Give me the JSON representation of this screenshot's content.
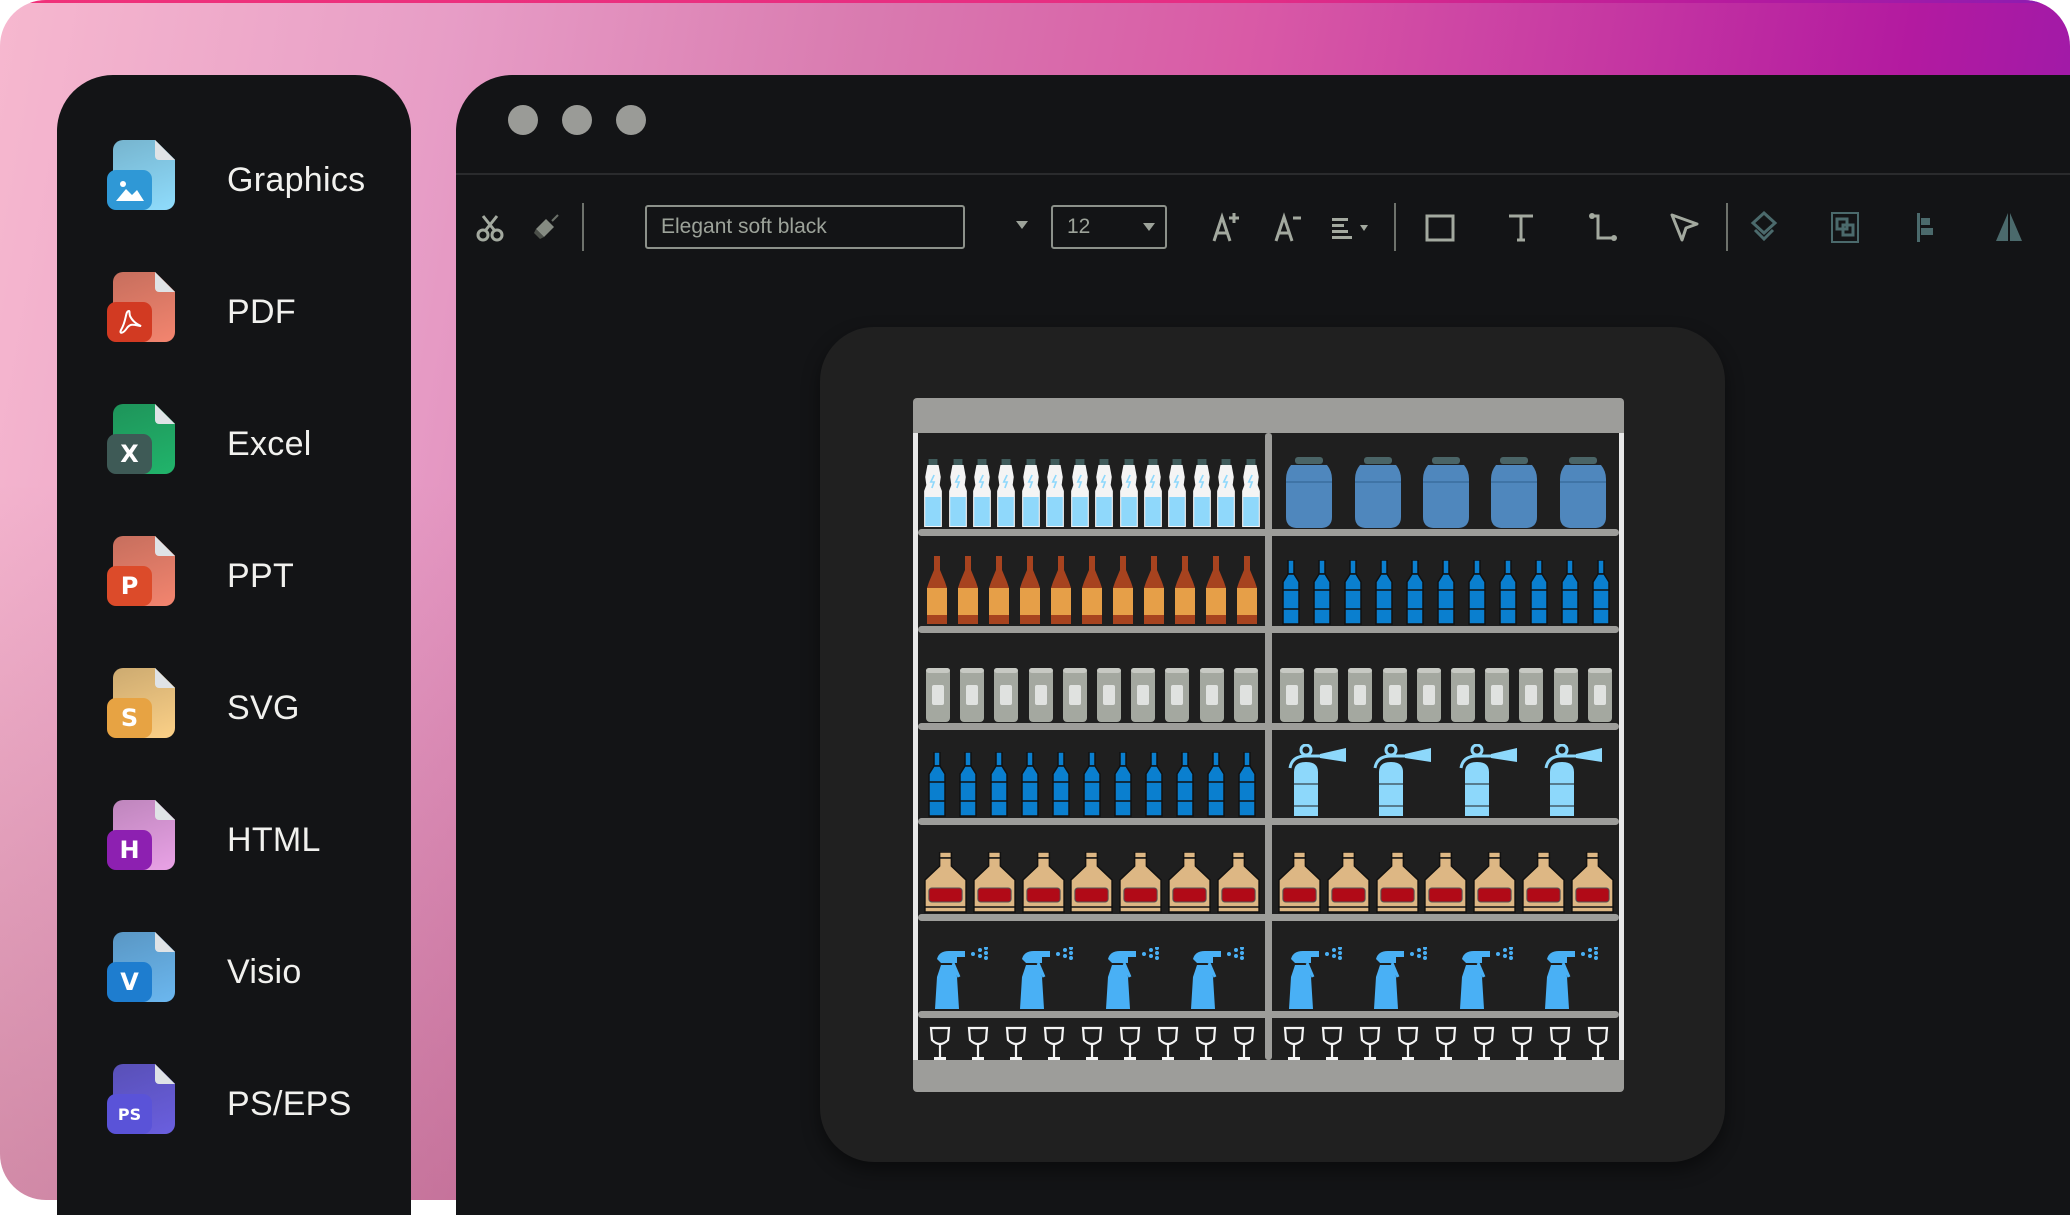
{
  "sidebar": {
    "items": [
      {
        "label": "Graphics",
        "icon": "image-file-icon",
        "badge": "",
        "sheet": "#8fdcfc",
        "badge_color": "#2f98d6"
      },
      {
        "label": "PDF",
        "icon": "pdf-file-icon",
        "badge": "",
        "sheet": "#f3856f",
        "badge_color": "#d23a22"
      },
      {
        "label": "Excel",
        "icon": "excel-file-icon",
        "badge": "X",
        "sheet": "#21b46b",
        "badge_color": "#3e5a56"
      },
      {
        "label": "PPT",
        "icon": "ppt-file-icon",
        "badge": "P",
        "sheet": "#f3856f",
        "badge_color": "#dc4b2a"
      },
      {
        "label": "SVG",
        "icon": "svg-file-icon",
        "badge": "S",
        "sheet": "#fbd087",
        "badge_color": "#e7a343"
      },
      {
        "label": "HTML",
        "icon": "html-file-icon",
        "badge": "H",
        "sheet": "#e9a2e6",
        "badge_color": "#8d20b1"
      },
      {
        "label": "Visio",
        "icon": "visio-file-icon",
        "badge": "V",
        "sheet": "#6bb7ef",
        "badge_color": "#1e7dcf"
      },
      {
        "label": "PS/EPS",
        "icon": "ps-eps-file-icon",
        "badge": "PS",
        "sheet": "#6a5fdf",
        "badge_color": "#5a53d8"
      }
    ]
  },
  "window": {
    "traffic_lights": [
      "close",
      "minimize",
      "maximize"
    ]
  },
  "toolbar": {
    "font_name": "Elegant soft black",
    "font_size": "12",
    "tools": [
      {
        "name": "cut",
        "icon": "scissors-icon"
      },
      {
        "name": "format-painter",
        "icon": "paint-brush-icon"
      },
      {
        "name": "increase-font",
        "icon": "font-increase-icon"
      },
      {
        "name": "decrease-font",
        "icon": "font-decrease-icon"
      },
      {
        "name": "align-text",
        "icon": "align-left-icon"
      },
      {
        "name": "rectangle",
        "icon": "rectangle-icon"
      },
      {
        "name": "text",
        "icon": "text-tool-icon"
      },
      {
        "name": "connector",
        "icon": "connector-icon"
      },
      {
        "name": "select",
        "icon": "pointer-icon"
      },
      {
        "name": "layers",
        "icon": "layers-icon"
      },
      {
        "name": "group",
        "icon": "group-icon"
      },
      {
        "name": "align-objects",
        "icon": "align-objects-icon"
      },
      {
        "name": "flip",
        "icon": "flip-icon"
      }
    ]
  },
  "canvas": {
    "diagram": "store shelf planogram",
    "rows": [
      {
        "left": {
          "item": "water-bottle",
          "count": 14
        },
        "right": {
          "item": "jar",
          "count": 5
        }
      },
      {
        "left": {
          "item": "beer-bottle",
          "count": 11
        },
        "right": {
          "item": "blue-bottle",
          "count": 11
        }
      },
      {
        "left": {
          "item": "can",
          "count": 10
        },
        "right": {
          "item": "can",
          "count": 10
        }
      },
      {
        "left": {
          "item": "blue-bottle",
          "count": 11
        },
        "right": {
          "item": "fire-extinguisher",
          "count": 4
        }
      },
      {
        "left": {
          "item": "sauce-bottle",
          "count": 7
        },
        "right": {
          "item": "sauce-bottle",
          "count": 7
        }
      },
      {
        "left": {
          "item": "spray-bottle",
          "count": 4
        },
        "right": {
          "item": "spray-bottle",
          "count": 4
        }
      },
      {
        "left": {
          "item": "wine-glass",
          "count": 9
        },
        "right": {
          "item": "wine-glass",
          "count": 9
        }
      }
    ]
  }
}
